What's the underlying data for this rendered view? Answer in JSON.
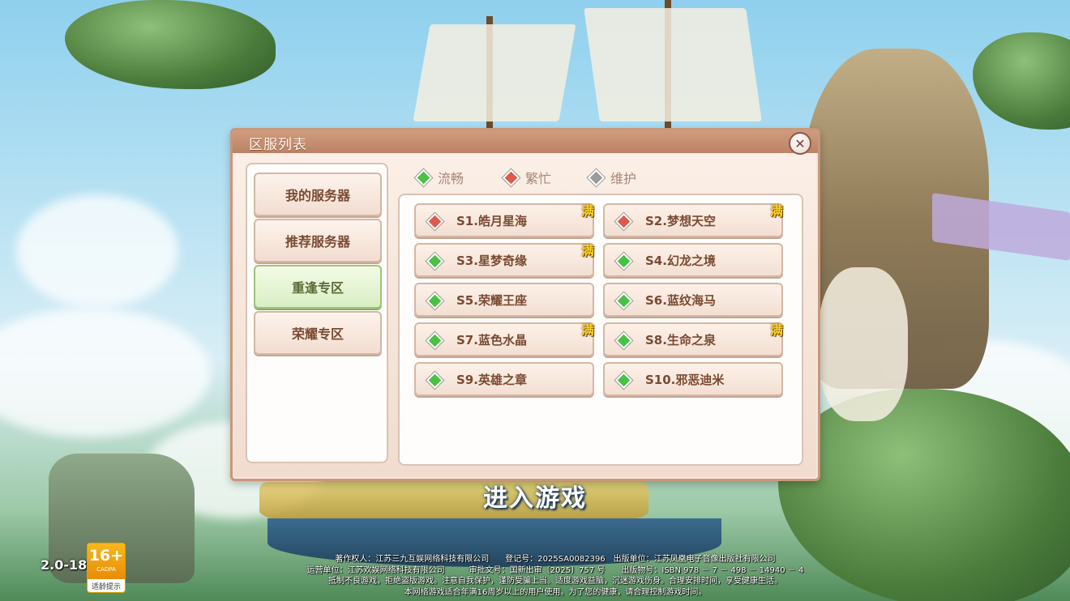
{
  "dialog": {
    "title": "区服列表",
    "close_symbol": "✕"
  },
  "menu": [
    {
      "label": "我的服务器",
      "active": false
    },
    {
      "label": "推荐服务器",
      "active": false
    },
    {
      "label": "重逢专区",
      "active": true
    },
    {
      "label": "荣耀专区",
      "active": false
    }
  ],
  "legend": [
    {
      "label": "流畅",
      "color": "#49c243"
    },
    {
      "label": "繁忙",
      "color": "#e05a4c"
    },
    {
      "label": "维护",
      "color": "#9b9b9b"
    }
  ],
  "full_label": "满",
  "servers": [
    {
      "name": "S1.皓月星海",
      "status": "busy",
      "full": true
    },
    {
      "name": "S2.梦想天空",
      "status": "busy",
      "full": true
    },
    {
      "name": "S3.星梦奇缘",
      "status": "smooth",
      "full": true
    },
    {
      "name": "S4.幻龙之境",
      "status": "smooth",
      "full": false
    },
    {
      "name": "S5.荣耀王座",
      "status": "smooth",
      "full": false
    },
    {
      "name": "S6.蓝纹海马",
      "status": "smooth",
      "full": false
    },
    {
      "name": "S7.蓝色水晶",
      "status": "smooth",
      "full": true
    },
    {
      "name": "S8.生命之泉",
      "status": "smooth",
      "full": true
    },
    {
      "name": "S9.英雄之章",
      "status": "smooth",
      "full": false
    },
    {
      "name": "S10.邪恶迪米",
      "status": "smooth",
      "full": false
    }
  ],
  "enter_button": "进入游戏",
  "version": "2.0-18",
  "age_rating": {
    "number": "16+",
    "org": "CADPA",
    "tip": "适龄提示"
  },
  "footer_lines": [
    "著作权人：江苏三九互娱网络科技有限公司　　登记号：2025SA0082396　出版单位：江苏凤凰电子音像出版社有限公司",
    "运营单位：江苏欢娱网络科技有限公司　　　审批文号：国新出审〔2025〕757 号　　出版物号：ISBN 978 － 7 － 498 － 14940 － 4",
    "抵制不良游戏，拒绝盗版游戏。注意自我保护，谨防受骗上当。适度游戏益脑，沉迷游戏伤身。合理安排时间，享受健康生活。",
    "本网络游戏适合年满16周岁以上的用户使用。为了您的健康，请合理控制游戏时间。"
  ]
}
